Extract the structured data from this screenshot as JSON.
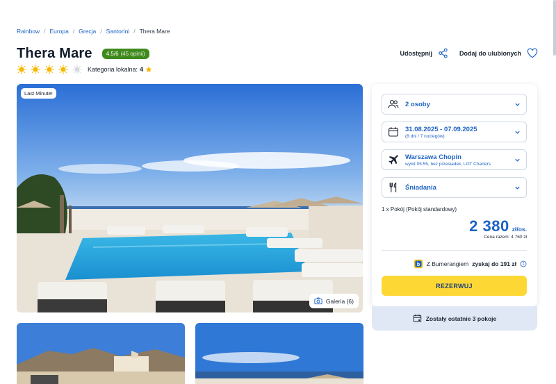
{
  "breadcrumb": [
    "Rainbow",
    "Europa",
    "Grecja",
    "Santorini",
    "Thera Mare"
  ],
  "hotel": {
    "name": "Thera Mare",
    "rating": "4.5/6",
    "reviews": "(45 opinii)",
    "suns_total": 5,
    "suns_filled": 4,
    "local_category_label": "Kategoria lokalna:",
    "local_category_value": "4"
  },
  "actions": {
    "share": "Udostępnij",
    "favorite": "Dodaj do ulubionych"
  },
  "gallery": {
    "badge": "Last Minute!",
    "button": "Galeria (6)"
  },
  "booking": {
    "persons": "2 osoby",
    "dates": "31.08.2025 - 07.09.2025",
    "dates_sub": "(8 dni / 7 noclegów)",
    "airport": "Warszawa Chopin",
    "airport_sub": "wylot 05:55, bez przesiadek, LOT Charters",
    "board": "Śniadania",
    "room": "1 x Pokój  (Pokój standardowy)",
    "price": "2 380",
    "price_unit": "zł/os.",
    "total": "Cena razem: 4 760 zł",
    "bumerang_prefix": "Z Bumerangiem",
    "bumerang_highlight": "zyskaj do 191 zł",
    "reserve": "REZERWUJ",
    "rooms_left": "Zostały ostatnie 3 pokoje"
  },
  "colors": {
    "accent": "#1d63c4",
    "rating": "#3f8a1d",
    "cta": "#fdd835",
    "sun": "#f5b800"
  }
}
